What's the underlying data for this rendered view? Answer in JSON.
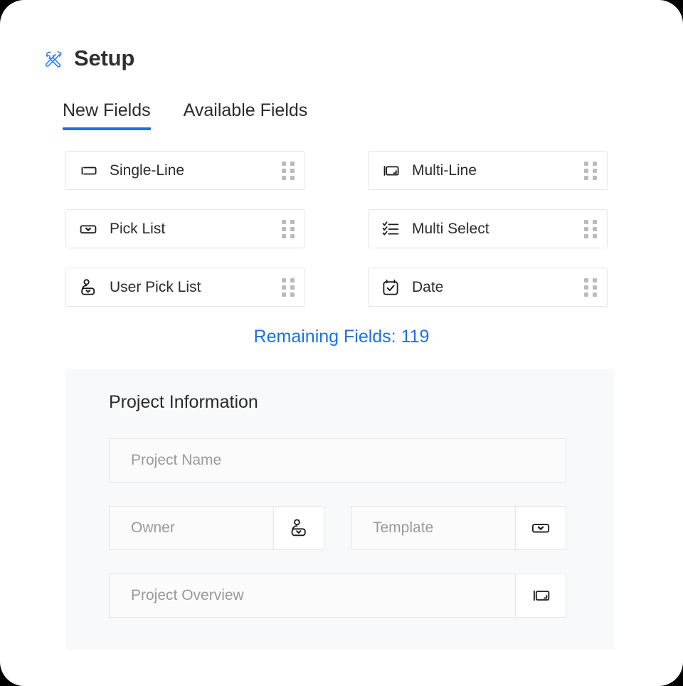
{
  "header": {
    "title": "Setup",
    "icon": "tools-icon"
  },
  "tabs": [
    {
      "label": "New Fields",
      "active": true
    },
    {
      "label": "Available Fields",
      "active": false
    }
  ],
  "new_fields": [
    {
      "label": "Single-Line",
      "icon": "single-line-icon"
    },
    {
      "label": "Multi-Line",
      "icon": "multi-line-icon"
    },
    {
      "label": "Pick List",
      "icon": "pick-list-icon"
    },
    {
      "label": "Multi Select",
      "icon": "multi-select-icon"
    },
    {
      "label": "User Pick List",
      "icon": "user-pick-list-icon"
    },
    {
      "label": "Date",
      "icon": "date-icon"
    }
  ],
  "remaining_fields": {
    "label": "Remaining Fields: 119",
    "count": 119
  },
  "preview": {
    "title": "Project Information",
    "fields": [
      {
        "placeholder": "Project Name",
        "addon_icon": null
      },
      {
        "placeholder": "Owner",
        "addon_icon": "user-pick-list-icon"
      },
      {
        "placeholder": "Template",
        "addon_icon": "pick-list-icon"
      },
      {
        "placeholder": "Project Overview",
        "addon_icon": "multi-line-icon"
      }
    ]
  },
  "colors": {
    "accent": "#1f6fe5",
    "text": "#2b2b2b",
    "placeholder": "#9a9a9a",
    "panel_bg": "#f8f9fa",
    "border": "#e6e6e6"
  }
}
